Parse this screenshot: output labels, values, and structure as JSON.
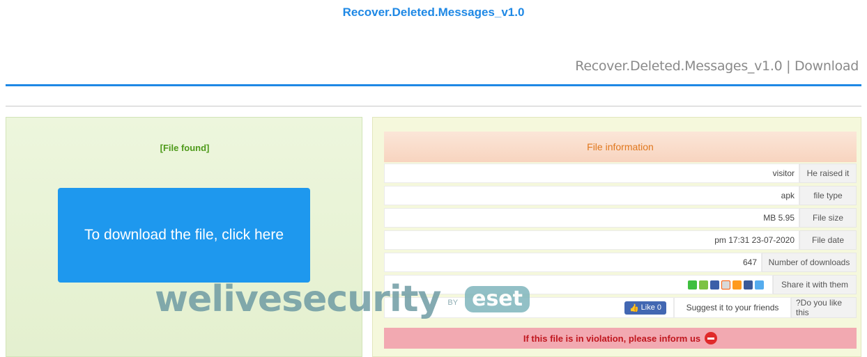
{
  "site_title": "Recover.Deleted.Messages_v1.0",
  "page_heading": "Recover.Deleted.Messages_v1.0 | Download",
  "left": {
    "status": "[File found]",
    "download_label": "To download the file, click here"
  },
  "info": {
    "header": "File information",
    "rows": [
      {
        "value": "visitor",
        "label": "He raised it"
      },
      {
        "value": "apk",
        "label": "file type"
      },
      {
        "value": "MB 5.95",
        "label": "File size"
      },
      {
        "value": "pm 17:31 23-07-2020",
        "label": "File date"
      },
      {
        "value": "647",
        "label": "Number of downloads"
      }
    ],
    "share_label": "Share it with them",
    "share_icons": [
      "line-icon",
      "wechat-icon",
      "messenger-icon",
      "reddit-icon",
      "myspace-icon",
      "facebook-icon",
      "twitter-icon"
    ],
    "like_button": "Like 0",
    "suggest_label": "Suggest it to your friends",
    "do_you_like": "?Do you like this",
    "violation": "If this file is in violation, please inform us"
  },
  "watermark": {
    "brand": "welivesecurity",
    "by": "BY",
    "eset": "eset"
  }
}
